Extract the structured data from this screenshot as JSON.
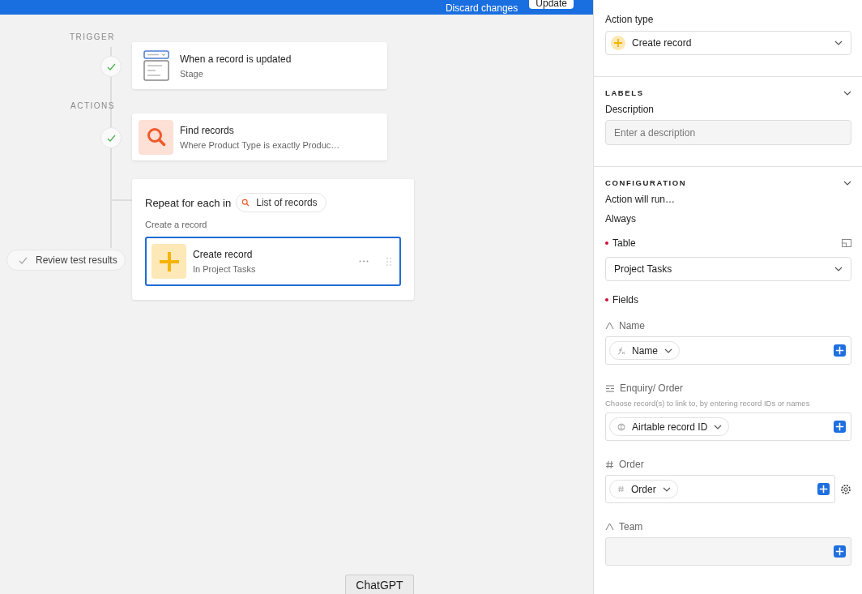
{
  "top_bar": {
    "discard_label": "Discard changes",
    "update_label": "Update"
  },
  "canvas": {
    "trigger_heading": "TRIGGER",
    "trigger": {
      "title": "When a record is updated",
      "subtitle": "Stage",
      "done": true
    },
    "actions_heading": "ACTIONS",
    "actions": [
      {
        "kind": "find",
        "title": "Find records",
        "subtitle": "Where Product Type is exactly Produc…",
        "done": true
      }
    ],
    "repeat": {
      "label": "Repeat for each in",
      "source": "List of records",
      "caption": "Create a record",
      "step": {
        "title": "Create record",
        "subtitle": "In Project Tasks",
        "selected": true
      }
    },
    "review_button": "Review test results"
  },
  "panel": {
    "action_type": {
      "label": "Action type",
      "value": "Create record"
    },
    "labels_section": {
      "heading": "LABELS",
      "description_label": "Description",
      "placeholder": "Enter a description"
    },
    "configuration": {
      "heading": "CONFIGURATION",
      "run_label": "Action will run…",
      "run_value": "Always",
      "table_label": "Table",
      "table_required": true,
      "table_value": "Project Tasks",
      "fields_label": "Fields",
      "fields_required": true,
      "fields": [
        {
          "kind": "text",
          "label": "Name",
          "token": "Name"
        },
        {
          "kind": "link",
          "label": "Enquiry/ Order",
          "hint": "Choose record(s) to link to, by entering record IDs or names",
          "token": "Airtable record ID"
        },
        {
          "kind": "number",
          "label": "Order",
          "token": "Order",
          "settings": true
        },
        {
          "kind": "text",
          "label": "Team"
        }
      ]
    }
  },
  "bottom_tab": "ChatGPT"
}
